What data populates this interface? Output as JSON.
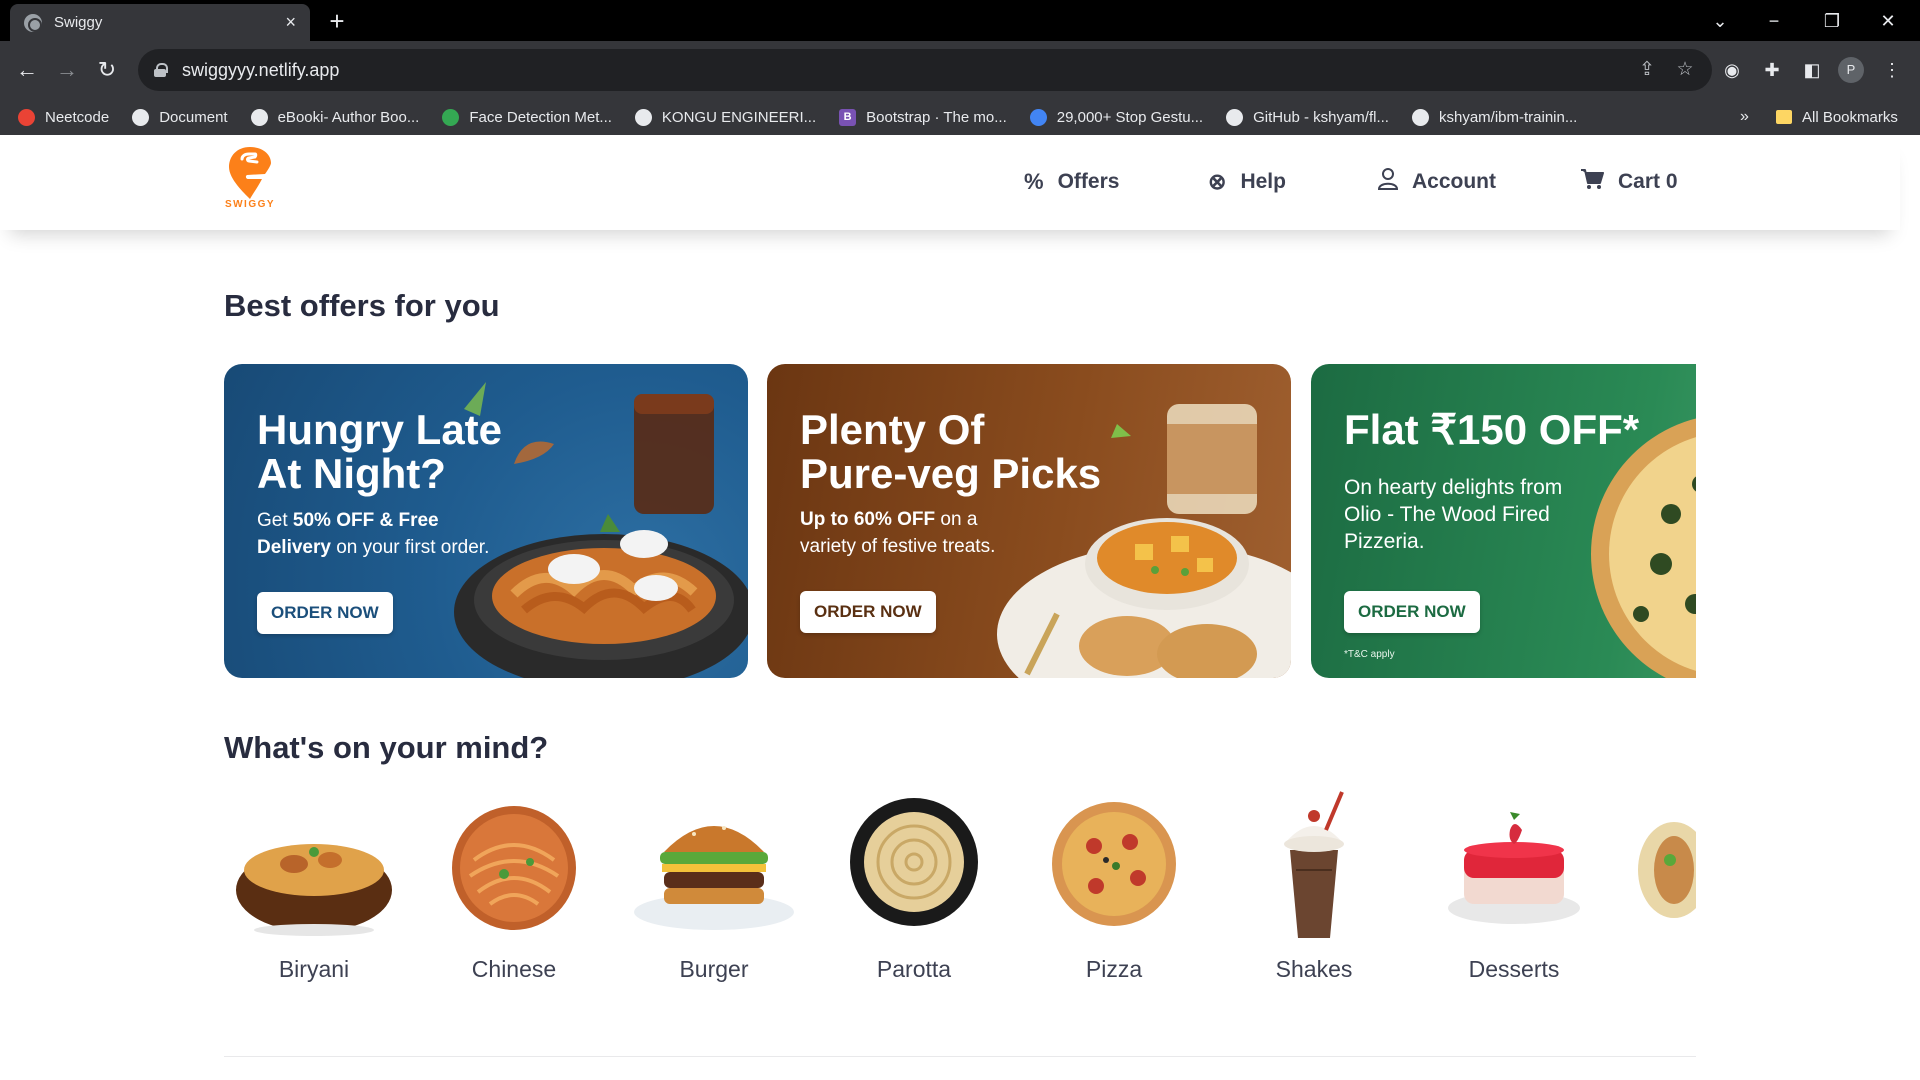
{
  "browser": {
    "tab_title": "Swiggy",
    "tab_close": "×",
    "new_tab": "+",
    "url": "swiggyyy.netlify.app",
    "profile_initial": "P",
    "bookmarks": [
      {
        "label": "Neetcode",
        "icon": "pin-icon",
        "color": "#ea4335"
      },
      {
        "label": "Document",
        "icon": "globe-icon",
        "color": "#e8eaed"
      },
      {
        "label": "eBooki- Author Boo...",
        "icon": "globe-icon",
        "color": "#e8eaed"
      },
      {
        "label": "Face Detection Met...",
        "icon": "ring-icon",
        "color": "#34a853"
      },
      {
        "label": "KONGU ENGINEERI...",
        "icon": "globe-icon",
        "color": "#e8eaed"
      },
      {
        "label": "Bootstrap · The mo...",
        "icon": "bootstrap-icon",
        "color": "#7952b3"
      },
      {
        "label": "29,000+ Stop Gestu...",
        "icon": "robot-icon",
        "color": "#4285f4"
      },
      {
        "label": "GitHub - kshyam/fl...",
        "icon": "github-icon",
        "color": "#e8eaed"
      },
      {
        "label": "kshyam/ibm-trainin...",
        "icon": "github-icon",
        "color": "#e8eaed"
      }
    ],
    "bookmarks_more": "»",
    "all_bookmarks": "All Bookmarks"
  },
  "header": {
    "logo_text": "SWIGGY",
    "nav": {
      "offers": "Offers",
      "help": "Help",
      "account": "Account",
      "cart": "Cart 0"
    }
  },
  "offers_section": {
    "title": "Best offers for you",
    "cards": [
      {
        "title_line1": "Hungry Late",
        "title_line2": "At Night?",
        "sub_pre": "Get ",
        "sub_bold": "50% OFF & Free",
        "sub_bold2": "Delivery",
        "sub_post": " on your first order.",
        "button": "ORDER NOW",
        "bg": "#1f5c8f",
        "button_color": "#1b4f7b"
      },
      {
        "title_line1": "Plenty Of",
        "title_line2": "Pure-veg Picks",
        "sub_bold": "Up to 60% OFF",
        "sub_post": " on a",
        "sub_line2": "variety of festive treats.",
        "button": "ORDER NOW",
        "bg": "#7a4118",
        "button_color": "#5a3012"
      },
      {
        "title_line1": "Flat ₹150 OFF*",
        "sub_line1": "On hearty delights from",
        "sub_line2": "Olio - The Wood Fired",
        "sub_line3": "Pizzeria.",
        "button": "ORDER NOW",
        "terms": "*T&C apply",
        "bg": "#1e7a4a",
        "button_color": "#1c6b42"
      }
    ]
  },
  "mind_section": {
    "title": "What's on your mind?",
    "categories": [
      {
        "label": "Biryani"
      },
      {
        "label": "Chinese"
      },
      {
        "label": "Burger"
      },
      {
        "label": "Parotta"
      },
      {
        "label": "Pizza"
      },
      {
        "label": "Shakes"
      },
      {
        "label": "Desserts"
      }
    ]
  },
  "colors": {
    "brand": "#fc8019",
    "text_dark": "#282c3f",
    "text_nav": "#3d4152"
  }
}
